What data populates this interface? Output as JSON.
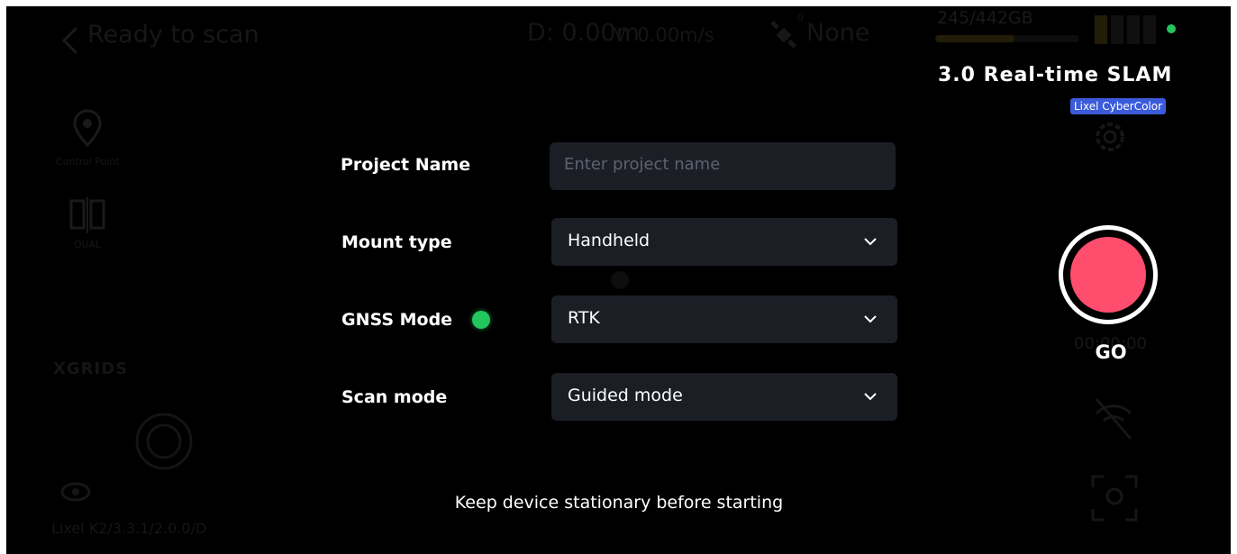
{
  "header": {
    "title": "Ready to scan",
    "distance": "D: 0.00m",
    "velocity": "V: 0.00m/s",
    "satellite_count": "0",
    "gnss_status": "None",
    "storage": "245/442GB",
    "storage_used_fraction": 0.55
  },
  "sidebar": {
    "tools": [
      {
        "label": "Control Point",
        "icon": "map-pin-icon"
      },
      {
        "label": "QUAL",
        "icon": "split-view-icon"
      }
    ],
    "brand": "XGRIDS",
    "version": "Lixel K2/3.3.1/2.0.0/D"
  },
  "right_panel": {
    "mode_title": "3.0 Real-time SLAM",
    "brand_badge": "Lixel CyberColor",
    "timer": "00:00:00",
    "record_label": "GO"
  },
  "form": {
    "project_name": {
      "label": "Project Name",
      "placeholder": "Enter project name",
      "value": ""
    },
    "mount_type": {
      "label": "Mount type",
      "value": "Handheld"
    },
    "gnss_mode": {
      "label": "GNSS Mode",
      "value": "RTK",
      "status_color": "#22c55e"
    },
    "scan_mode": {
      "label": "Scan mode",
      "value": "Guided mode"
    }
  },
  "hint": "Keep device stationary before starting",
  "colors": {
    "background": "#000000",
    "field_bg": "#1c1e26",
    "record": "#ff4d6d",
    "status_ok": "#22c55e",
    "badge": "#3b5bdb"
  }
}
